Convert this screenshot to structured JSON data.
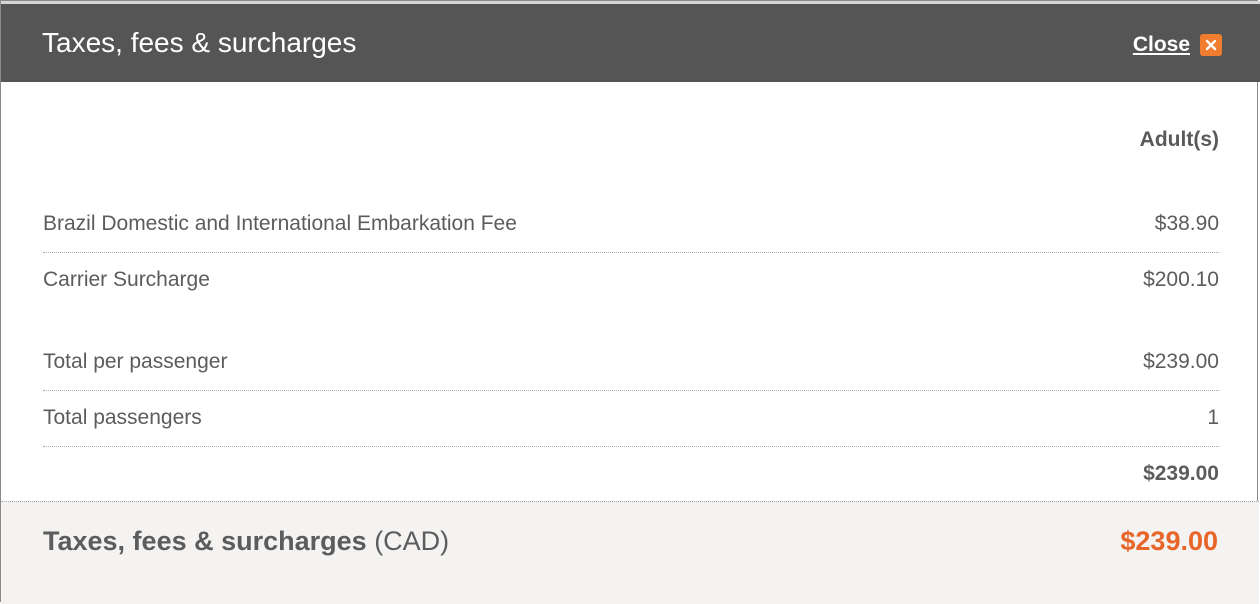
{
  "dialog": {
    "title": "Taxes, fees & surcharges",
    "close_label": "Close",
    "close_icon": "close-x-icon",
    "colors": {
      "header_bg": "#555555",
      "accent": "#f07c30",
      "total": "#e8652a",
      "footer_bg": "#f4f3f1"
    }
  },
  "table": {
    "column_header": "Adult(s)",
    "fees": [
      {
        "label": "Brazil Domestic and International Embarkation Fee",
        "amount": "$38.90"
      },
      {
        "label": "Carrier Surcharge",
        "amount": "$200.10"
      }
    ],
    "total_per_passenger": {
      "label": "Total per passenger",
      "amount": "$239.00"
    },
    "total_passengers": {
      "label": "Total passengers",
      "amount": "1"
    },
    "subtotal": "$239.00"
  },
  "footer": {
    "label_bold": "Taxes, fees & surcharges",
    "currency": "(CAD)",
    "total": "$239.00"
  }
}
